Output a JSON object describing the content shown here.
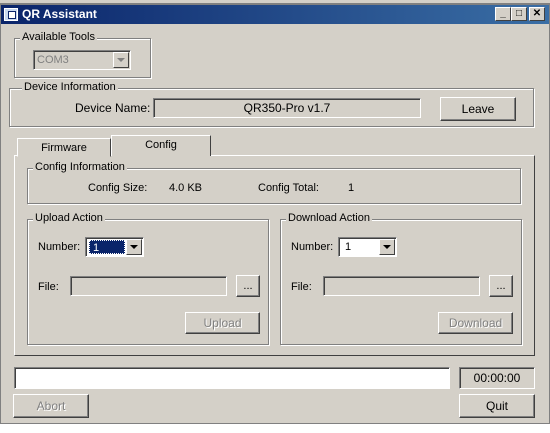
{
  "window": {
    "title": "QR Assistant"
  },
  "available_tools": {
    "legend": "Available Tools",
    "port_value": "COM3"
  },
  "device_information": {
    "legend": "Device Information",
    "device_name_label": "Device Name:",
    "device_name_value": "QR350-Pro v1.7",
    "leave_label": "Leave"
  },
  "tabs": [
    {
      "label": "Firmware"
    },
    {
      "label": "Config"
    }
  ],
  "config_information": {
    "legend": "Config Information",
    "size_label": "Config Size:",
    "size_value": "4.0 KB",
    "total_label": "Config Total:",
    "total_value": "1"
  },
  "upload_action": {
    "legend": "Upload Action",
    "number_label": "Number:",
    "number_value": "1",
    "file_label": "File:",
    "browse_label": "...",
    "button_label": "Upload"
  },
  "download_action": {
    "legend": "Download Action",
    "number_label": "Number:",
    "number_value": "1",
    "file_label": "File:",
    "browse_label": "...",
    "button_label": "Download"
  },
  "progress": {
    "timer": "00:00:00",
    "fraction": 0
  },
  "footer": {
    "abort_label": "Abort",
    "quit_label": "Quit"
  },
  "colors": {
    "titlebar_start": "#0a246a",
    "titlebar_end": "#3a6ea5",
    "face": "#d4d0c8",
    "selection": "#0a246a"
  }
}
